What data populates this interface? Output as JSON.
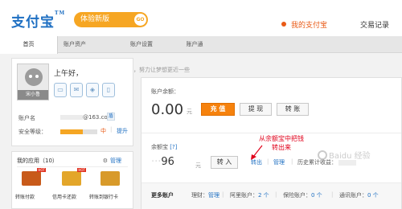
{
  "header": {
    "logo_text": "支付宝",
    "logo_mark": "TM",
    "beta_label": "体验新版",
    "beta_go": "GO",
    "my_alipay": "我的支付宝",
    "records": "交易记录"
  },
  "nav": {
    "tabs": [
      {
        "label": "首页",
        "active": true
      },
      {
        "label": "账户资产",
        "active": false
      },
      {
        "label": "账户设置",
        "active": false
      },
      {
        "label": "账户通",
        "active": false
      }
    ]
  },
  "profile": {
    "greeting": "上午好，",
    "motto": "每一天，努力让梦想更近一些",
    "avatar_name": "宋小鲁",
    "icons": [
      "id-card-icon",
      "mail-icon",
      "shield-icon",
      "phone-icon"
    ],
    "account_label": "账户名",
    "account_value": "@163.com",
    "account_tag": "盾",
    "security_label": "安全等级：",
    "security_level_text": "中",
    "security_fraction": 0.6,
    "security_upgrade": "提升"
  },
  "apps": {
    "title": "我的应用（10）",
    "manage": "管理",
    "items": [
      {
        "label": "转账付款",
        "hot": "HOT",
        "color": "#c85a1a"
      },
      {
        "label": "信用卡还款",
        "hot": "HOT",
        "color": "#e3a62a"
      },
      {
        "label": "转账到银行卡",
        "hot": "",
        "color": "#d89a2a"
      }
    ]
  },
  "balance": {
    "label": "账户余额：",
    "amount": "0.00",
    "unit": "元",
    "recharge": "充 值",
    "withdraw": "提 现",
    "transfer": "转 账"
  },
  "yuebao": {
    "label": "余额宝",
    "help": "[?]",
    "amount_tail": "96",
    "unit": "元",
    "transfer_in": "转 入",
    "transfer_out": "转出",
    "manage": "管理",
    "history_label": "历史累计收益："
  },
  "annotation": {
    "line1": "从余额宝中把钱",
    "line2": "转出来"
  },
  "more_accounts": {
    "title": "更多账户",
    "items": [
      {
        "label": "理财：",
        "value": "管理"
      },
      {
        "label": "阿里账户：",
        "value": "2 个"
      },
      {
        "label": "保险账户：",
        "value": "0 个"
      },
      {
        "label": "通讯账户：",
        "value": "0 个"
      }
    ]
  },
  "watermark": "Baidu 经验",
  "colors": {
    "brand_blue": "#1e6fc2",
    "accent_orange": "#f6820d",
    "annotation_red": "#e0001a"
  }
}
